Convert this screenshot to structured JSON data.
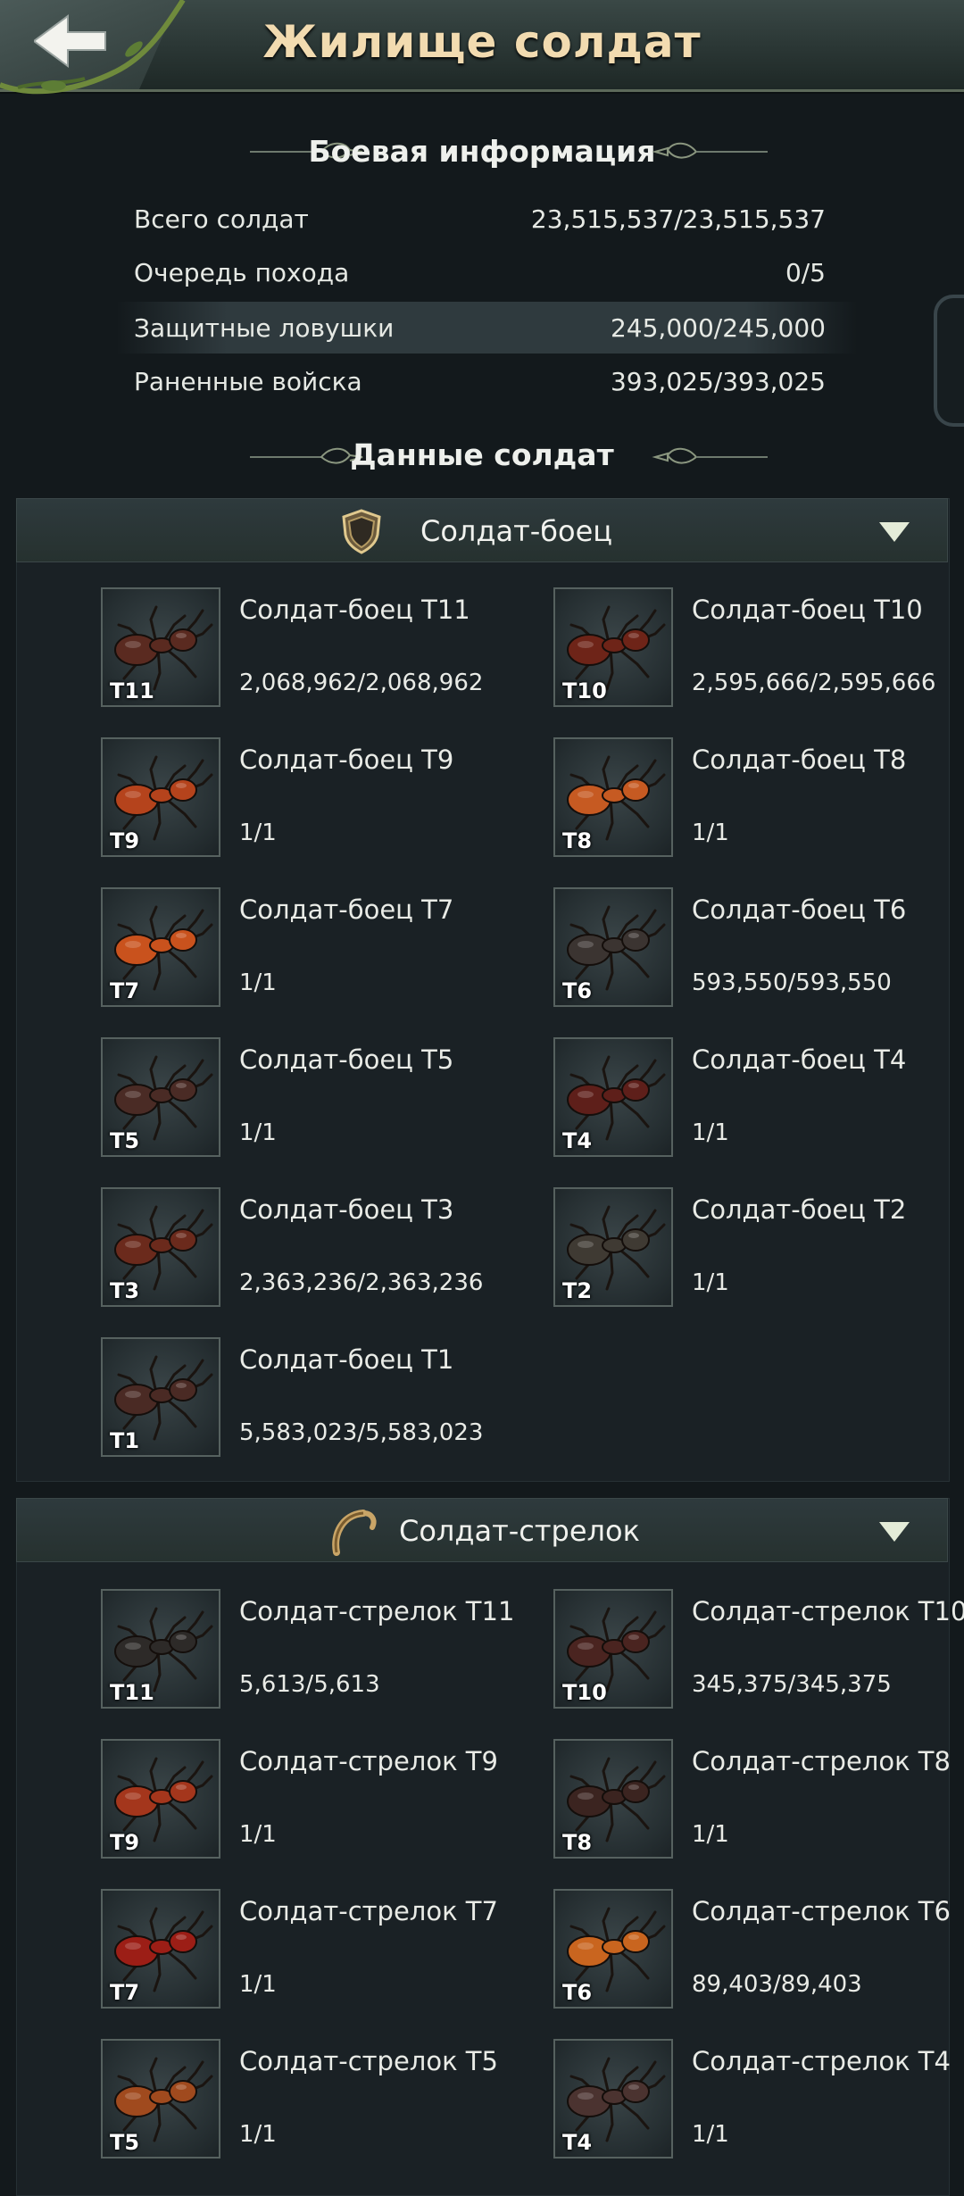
{
  "header": {
    "title": "Жилище солдат",
    "back_icon": "back-arrow-icon"
  },
  "battle_info": {
    "title": "Боевая информация",
    "rows": [
      {
        "label": "Всего солдат",
        "value": "23,515,537/23,515,537"
      },
      {
        "label": "Очередь похода",
        "value": "0/5"
      },
      {
        "label": "Защитные ловушки",
        "value": "245,000/245,000"
      },
      {
        "label": "Раненные войска",
        "value": "393,025/393,025"
      }
    ]
  },
  "soldier_data": {
    "title": "Данные солдат"
  },
  "categories": [
    {
      "label": "Солдат-боец",
      "icon": "shield-icon",
      "units": [
        {
          "tier": "T11",
          "name": "Солдат-боец T11",
          "count": "2,068,962/2,068,962",
          "color": "#5a2a20"
        },
        {
          "tier": "T10",
          "name": "Солдат-боец T10",
          "count": "2,595,666/2,595,666",
          "color": "#6e2418"
        },
        {
          "tier": "T9",
          "name": "Солдат-боец T9",
          "count": "1/1",
          "color": "#b5431c"
        },
        {
          "tier": "T8",
          "name": "Солдат-боец T8",
          "count": "1/1",
          "color": "#c65a22"
        },
        {
          "tier": "T7",
          "name": "Солдат-боец T7",
          "count": "1/1",
          "color": "#c9521d"
        },
        {
          "tier": "T6",
          "name": "Солдат-боец T6",
          "count": "593,550/593,550",
          "color": "#3b3431"
        },
        {
          "tier": "T5",
          "name": "Солдат-боец T5",
          "count": "1/1",
          "color": "#4a2b25"
        },
        {
          "tier": "T4",
          "name": "Солдат-боец T4",
          "count": "1/1",
          "color": "#5e1f1a"
        },
        {
          "tier": "T3",
          "name": "Солдат-боец T3",
          "count": "2,363,236/2,363,236",
          "color": "#6b2a1c"
        },
        {
          "tier": "T2",
          "name": "Солдат-боец T2",
          "count": "1/1",
          "color": "#3f3a33"
        },
        {
          "tier": "T1",
          "name": "Солдат-боец T1",
          "count": "5,583,023/5,583,023",
          "color": "#4a2a24"
        }
      ]
    },
    {
      "label": "Солдат-стрелок",
      "icon": "bow-icon",
      "units": [
        {
          "tier": "T11",
          "name": "Солдат-стрелок T11",
          "count": "5,613/5,613",
          "color": "#2d2a28"
        },
        {
          "tier": "T10",
          "name": "Солдат-стрелок T10",
          "count": "345,375/345,375",
          "color": "#4a2420"
        },
        {
          "tier": "T9",
          "name": "Солдат-стрелок T9",
          "count": "1/1",
          "color": "#a4361c"
        },
        {
          "tier": "T8",
          "name": "Солдат-стрелок T8",
          "count": "1/1",
          "color": "#3b2420"
        },
        {
          "tier": "T7",
          "name": "Солдат-стрелок T7",
          "count": "1/1",
          "color": "#9c1e16"
        },
        {
          "tier": "T6",
          "name": "Солдат-стрелок T6",
          "count": "89,403/89,403",
          "color": "#c9651f"
        },
        {
          "tier": "T5",
          "name": "Солдат-стрелок T5",
          "count": "1/1",
          "color": "#a04a1e"
        },
        {
          "tier": "T4",
          "name": "Солдат-стрелок T4",
          "count": "1/1",
          "color": "#4b3330"
        }
      ]
    }
  ],
  "colors": {
    "title_gold": "#f2dbb0",
    "panel_bg": "#1a2125",
    "background": "#13191c"
  }
}
